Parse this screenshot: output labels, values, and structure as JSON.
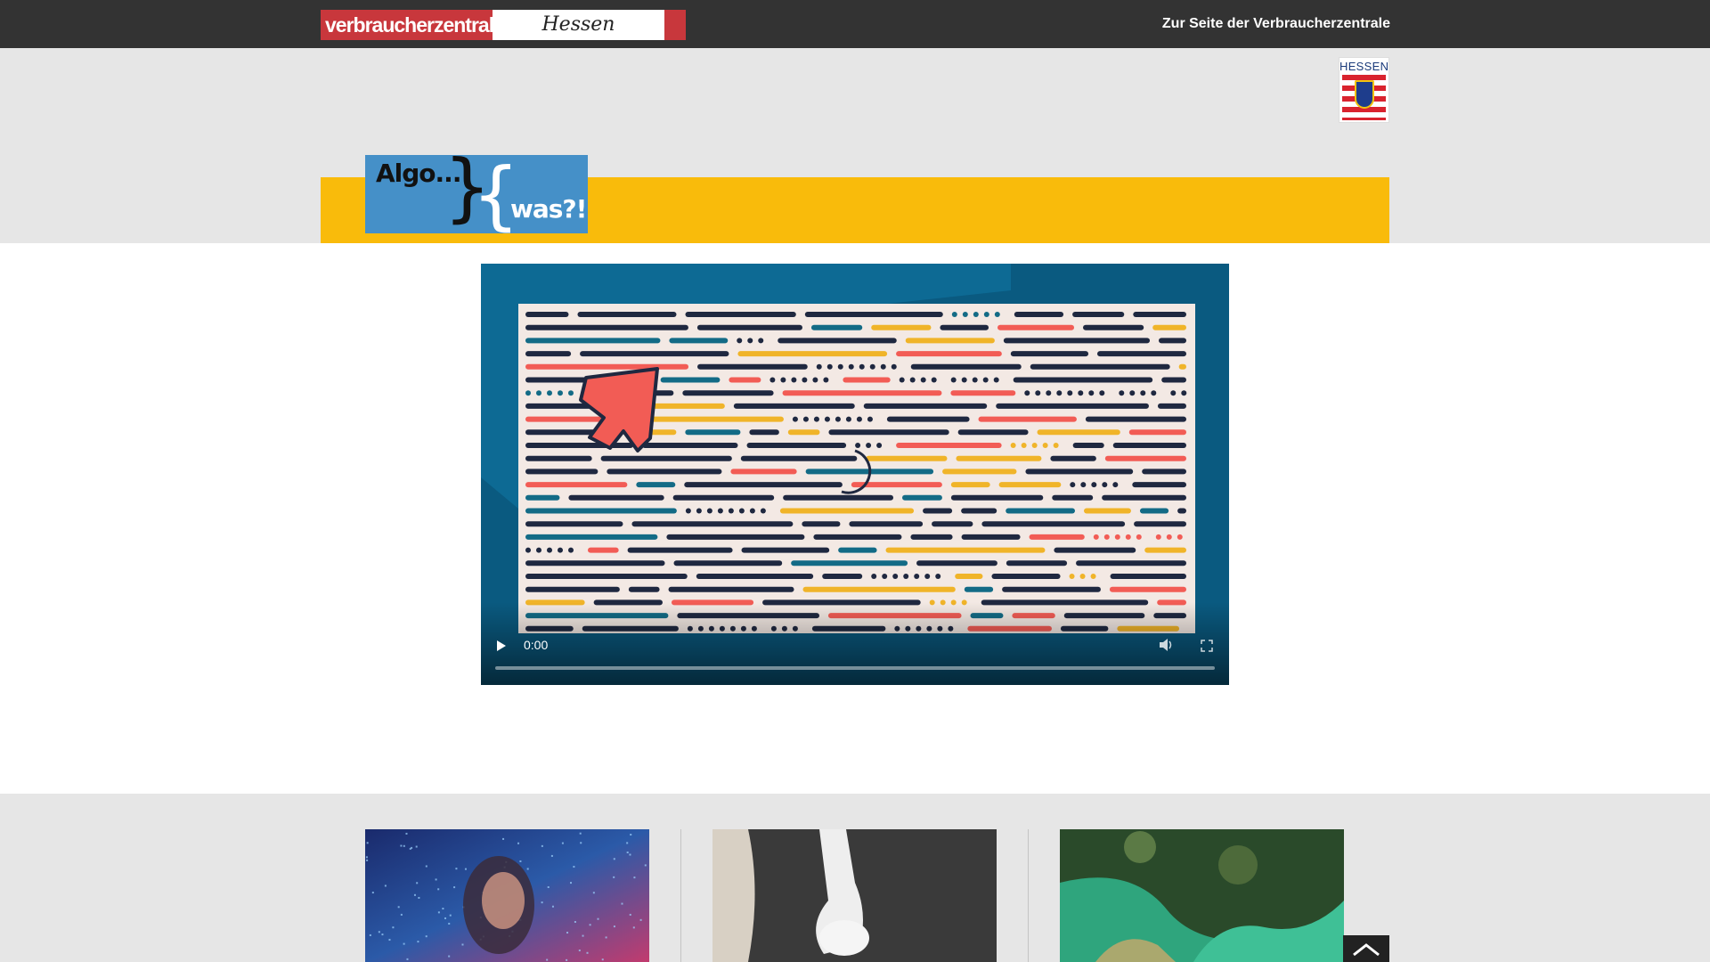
{
  "topbar": {
    "logo": {
      "brand": "verbraucherzentrale",
      "region": "Hessen"
    },
    "link_label": "Zur Seite der Verbraucherzentrale"
  },
  "header": {
    "state_logo_text": "HESSEN",
    "project_logo": {
      "part1": "Algo...",
      "part2": "was?!"
    }
  },
  "video": {
    "time": "0:00",
    "icons": {
      "play": "play-icon",
      "volume": "volume-icon",
      "fullscreen": "fullscreen-icon"
    }
  },
  "teasers": [
    {
      "image": "woman-with-code-projection-image"
    },
    {
      "image": "robot-hand-image"
    },
    {
      "image": "satellite-coastline-image"
    }
  ],
  "scroll_top": {
    "icon": "chevron-up-icon"
  },
  "colors": {
    "topbar": "#333333",
    "brand_red": "#c8373c",
    "header_band": "#e6e6e6",
    "yellow_bar": "#f9bb0b",
    "algo_blue": "#4590c8"
  }
}
